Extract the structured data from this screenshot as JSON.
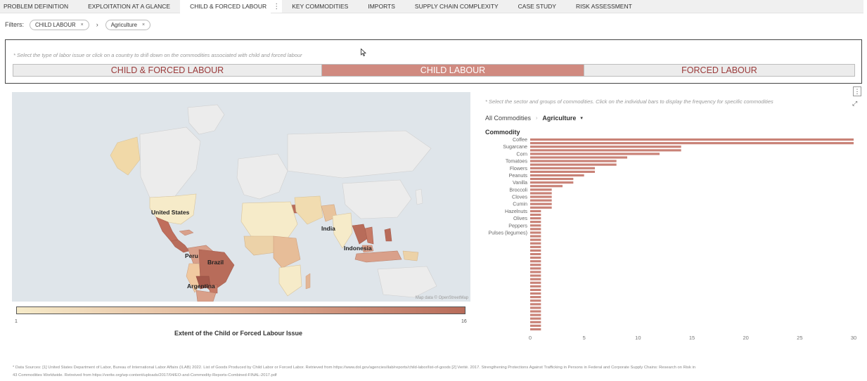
{
  "tabs": [
    {
      "label": "PROBLEM DEFINITION",
      "active": false
    },
    {
      "label": "EXPLOITATION AT A GLANCE",
      "active": false
    },
    {
      "label": "CHILD & FORCED LABOUR",
      "active": true
    },
    {
      "label": "KEY COMMODITIES",
      "active": false
    },
    {
      "label": "IMPORTS",
      "active": false
    },
    {
      "label": "SUPPLY CHAIN COMPLEXITY",
      "active": false
    },
    {
      "label": "CASE STUDY",
      "active": false
    },
    {
      "label": "RISK ASSESSMENT",
      "active": false
    }
  ],
  "tab_more_icon": "⋮",
  "filters": {
    "label": "Filters:",
    "chips": [
      "CHILD LABOUR",
      "Agriculture"
    ],
    "chip_remove_icon": "×",
    "separator": "›"
  },
  "selector": {
    "hint": "* Select the type of labor issue or click on a country to drill down on the commodities associated with child and forced labour",
    "buttons": [
      "CHILD & FORCED LABOUR",
      "CHILD LABOUR",
      "FORCED LABOUR"
    ],
    "active_index": 1
  },
  "map": {
    "labels": [
      "United States",
      "India",
      "Indonesia",
      "Peru",
      "Brazil",
      "Argentina"
    ],
    "attribution": "Map data © OpenStreetMap"
  },
  "legend": {
    "min": "1",
    "max": "16",
    "title": "Extent of the Child or Forced Labour Issue",
    "color_low": "#f6ebc9",
    "color_high": "#b86c5a"
  },
  "right_panel": {
    "hint": "* Select the sector and groups of commodities. Click on the individual bars to display the frequency for specific commodities",
    "crumb_all": "All Commodities",
    "crumb_sep": "›",
    "crumb_current": "Agriculture",
    "crumb_caret": "▾",
    "menu_icon": "⋮",
    "expand_icon": "⤢"
  },
  "chart_data": {
    "type": "bar",
    "orientation": "horizontal",
    "title": "Commodity",
    "bar_color": "#c98277",
    "xlim": [
      0,
      30
    ],
    "x_ticks": [
      0,
      5,
      10,
      15,
      20,
      25,
      30
    ],
    "labeled_categories": [
      "Coffee",
      "Sugarcane",
      "Corn",
      "Tomatoes",
      "Flowers",
      "Peanuts",
      "Vanilla",
      "Broccoli",
      "Cloves",
      "Cumin",
      "Hazelnuts",
      "Olives",
      "Peppers",
      "Pulses (legumes)"
    ],
    "label_every": 2,
    "values": [
      30,
      30,
      14,
      14,
      12,
      9,
      8,
      8,
      6,
      6,
      5,
      4,
      4,
      3,
      2,
      2,
      2,
      2,
      2,
      2,
      1,
      1,
      1,
      1,
      1,
      1,
      1,
      1,
      1,
      1,
      1,
      1,
      1,
      1,
      1,
      1,
      1,
      1,
      1,
      1,
      1,
      1,
      1,
      1,
      1,
      1,
      1,
      1,
      1,
      1,
      1,
      1,
      1,
      1
    ]
  },
  "footer": {
    "line1": "* Data Sources: [1] United States Department of Labor, Bureau of International Labor Affairs (ILAB) 2022. List of Goods Produced by Child Labor or Forced Labor. Retrieved from https://www.dol.gov/agencies/ilab/reports/child-labor/list-of-goods   [2] Verité. 2017. Strengthening Protections Against Trafficking in Persons in Federal and Corporate Supply Chains: Research on Risk in",
    "line2": "43 Commodities Worldwide. Retreived from https://verite.org/wp-content/uploads/2017/04/EO-and-Commodity-Reports-Combined-FINAL-2017.pdf"
  }
}
